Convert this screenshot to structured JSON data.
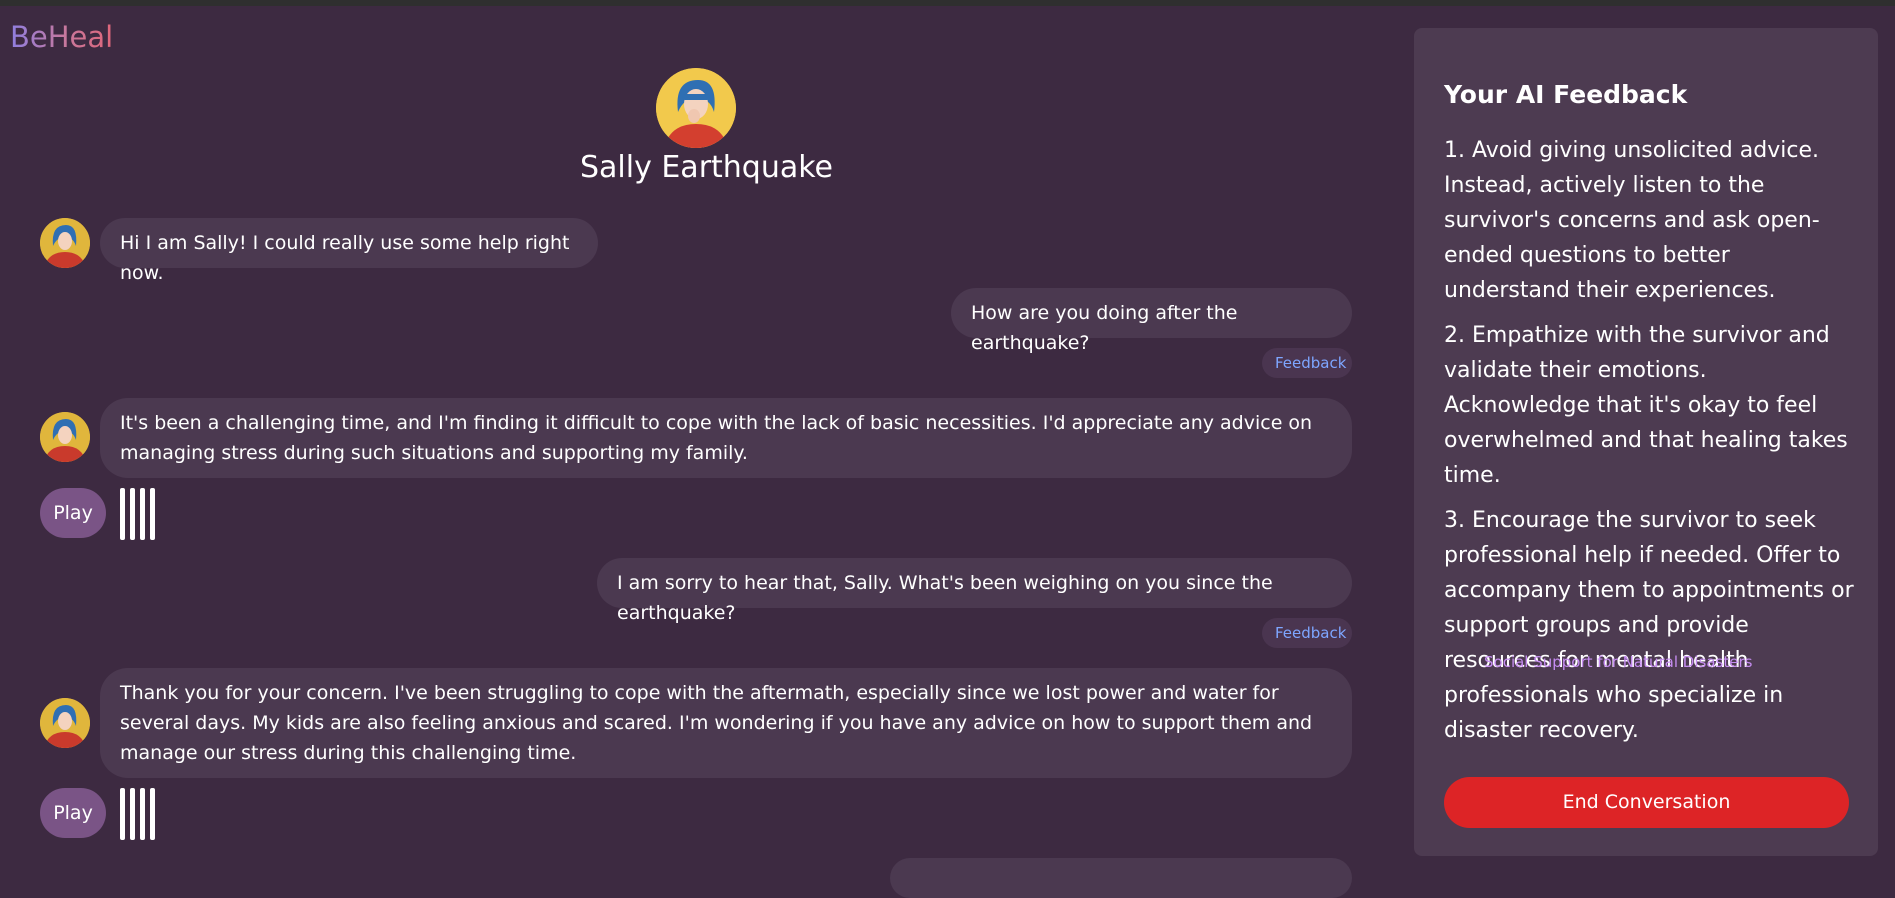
{
  "app": {
    "logo": "BeHeal"
  },
  "persona": {
    "name": "Sally Earthquake"
  },
  "messages": [
    {
      "role": "bot",
      "text": "Hi I am Sally! I could really use some help right now."
    },
    {
      "role": "user",
      "text": "How are you doing after the earthquake?",
      "feedback_label": "Feedback"
    },
    {
      "role": "bot",
      "text": "It's been a challenging time, and I'm finding it difficult to cope with the lack of basic necessities. I'd appreciate any advice on managing stress during such situations and supporting my family.",
      "play_label": "Play"
    },
    {
      "role": "user",
      "text": "I am sorry to hear that, Sally. What's been weighing on you since the earthquake?",
      "feedback_label": "Feedback"
    },
    {
      "role": "bot",
      "text": "Thank you for your concern. I've been struggling to cope with the aftermath, especially since we lost power and water for several days. My kids are also feeling anxious and scared. I'm wondering if you have any advice on how to support them and manage our stress during this challenging time.",
      "play_label": "Play"
    }
  ],
  "panel": {
    "title": "Your AI Feedback",
    "items": [
      "1. Avoid giving unsolicited advice. Instead, actively listen to the survivor's concerns and ask open-ended questions to better understand their experiences.",
      "2. Empathize with the survivor and validate their emotions. Acknowledge that it's okay to feel overwhelmed and that healing takes time.",
      "3. Encourage the survivor to seek professional help if needed. Offer to accompany them to appointments or support groups and provide resources for mental health professionals who specialize in disaster recovery."
    ],
    "link": "Social Support for Natural Disasters",
    "end_button": "End Conversation"
  },
  "colors": {
    "background": "#3d2a41",
    "bubble": "#4b3950",
    "panel": "#4d3b51",
    "play_button": "#7a5486",
    "feedback_text": "#7ea6ff",
    "link": "#c58cf0",
    "end_button": "#dd2426"
  },
  "icons": [
    "avatar-illustration",
    "audio-waveform-icon"
  ]
}
